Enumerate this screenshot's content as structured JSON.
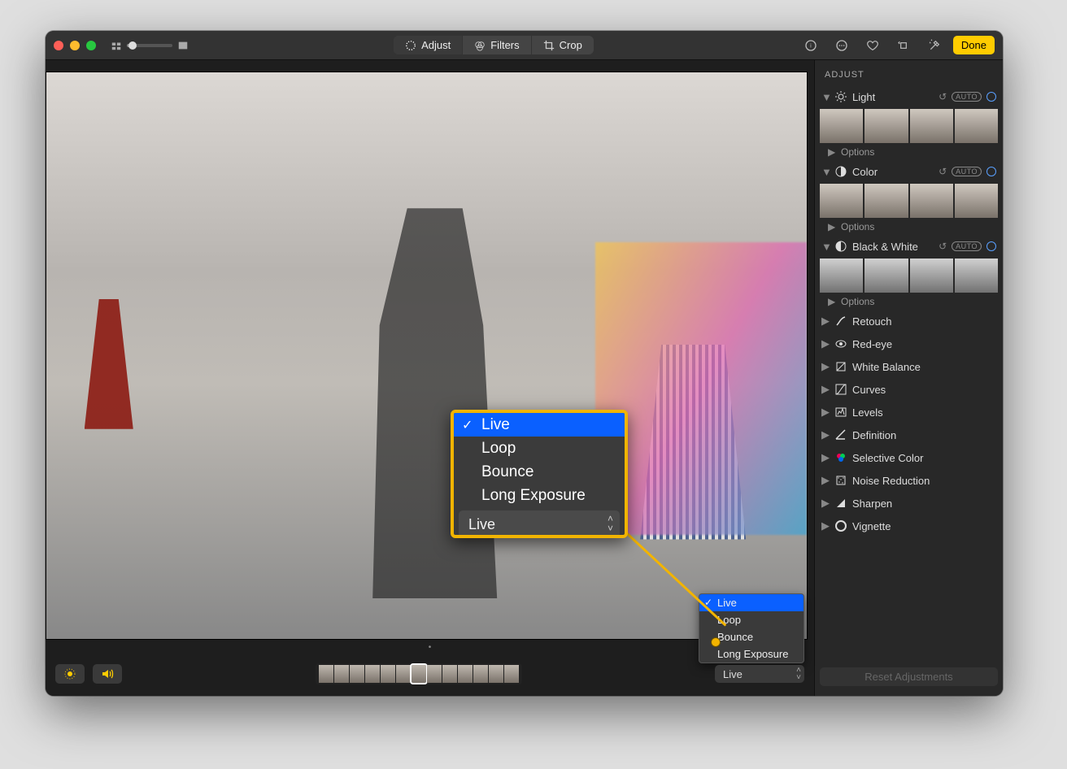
{
  "toolbar": {
    "adjust_label": "Adjust",
    "filters_label": "Filters",
    "crop_label": "Crop",
    "done_label": "Done"
  },
  "sidebar": {
    "title": "ADJUST",
    "options_label": "Options",
    "auto_label": "AUTO",
    "panels": {
      "light": "Light",
      "color": "Color",
      "bw": "Black & White",
      "retouch": "Retouch",
      "redeye": "Red-eye",
      "whitebalance": "White Balance",
      "curves": "Curves",
      "levels": "Levels",
      "definition": "Definition",
      "selectivecolor": "Selective Color",
      "noisereduction": "Noise Reduction",
      "sharpen": "Sharpen",
      "vignette": "Vignette"
    }
  },
  "live_menu": {
    "selected": "Live",
    "options": [
      "Live",
      "Loop",
      "Bounce",
      "Long Exposure"
    ]
  },
  "callout_menu": {
    "selected": "Live",
    "options": [
      "Live",
      "Loop",
      "Bounce",
      "Long Exposure"
    ]
  },
  "bottom": {
    "reset_label": "Reset Adjustments"
  }
}
